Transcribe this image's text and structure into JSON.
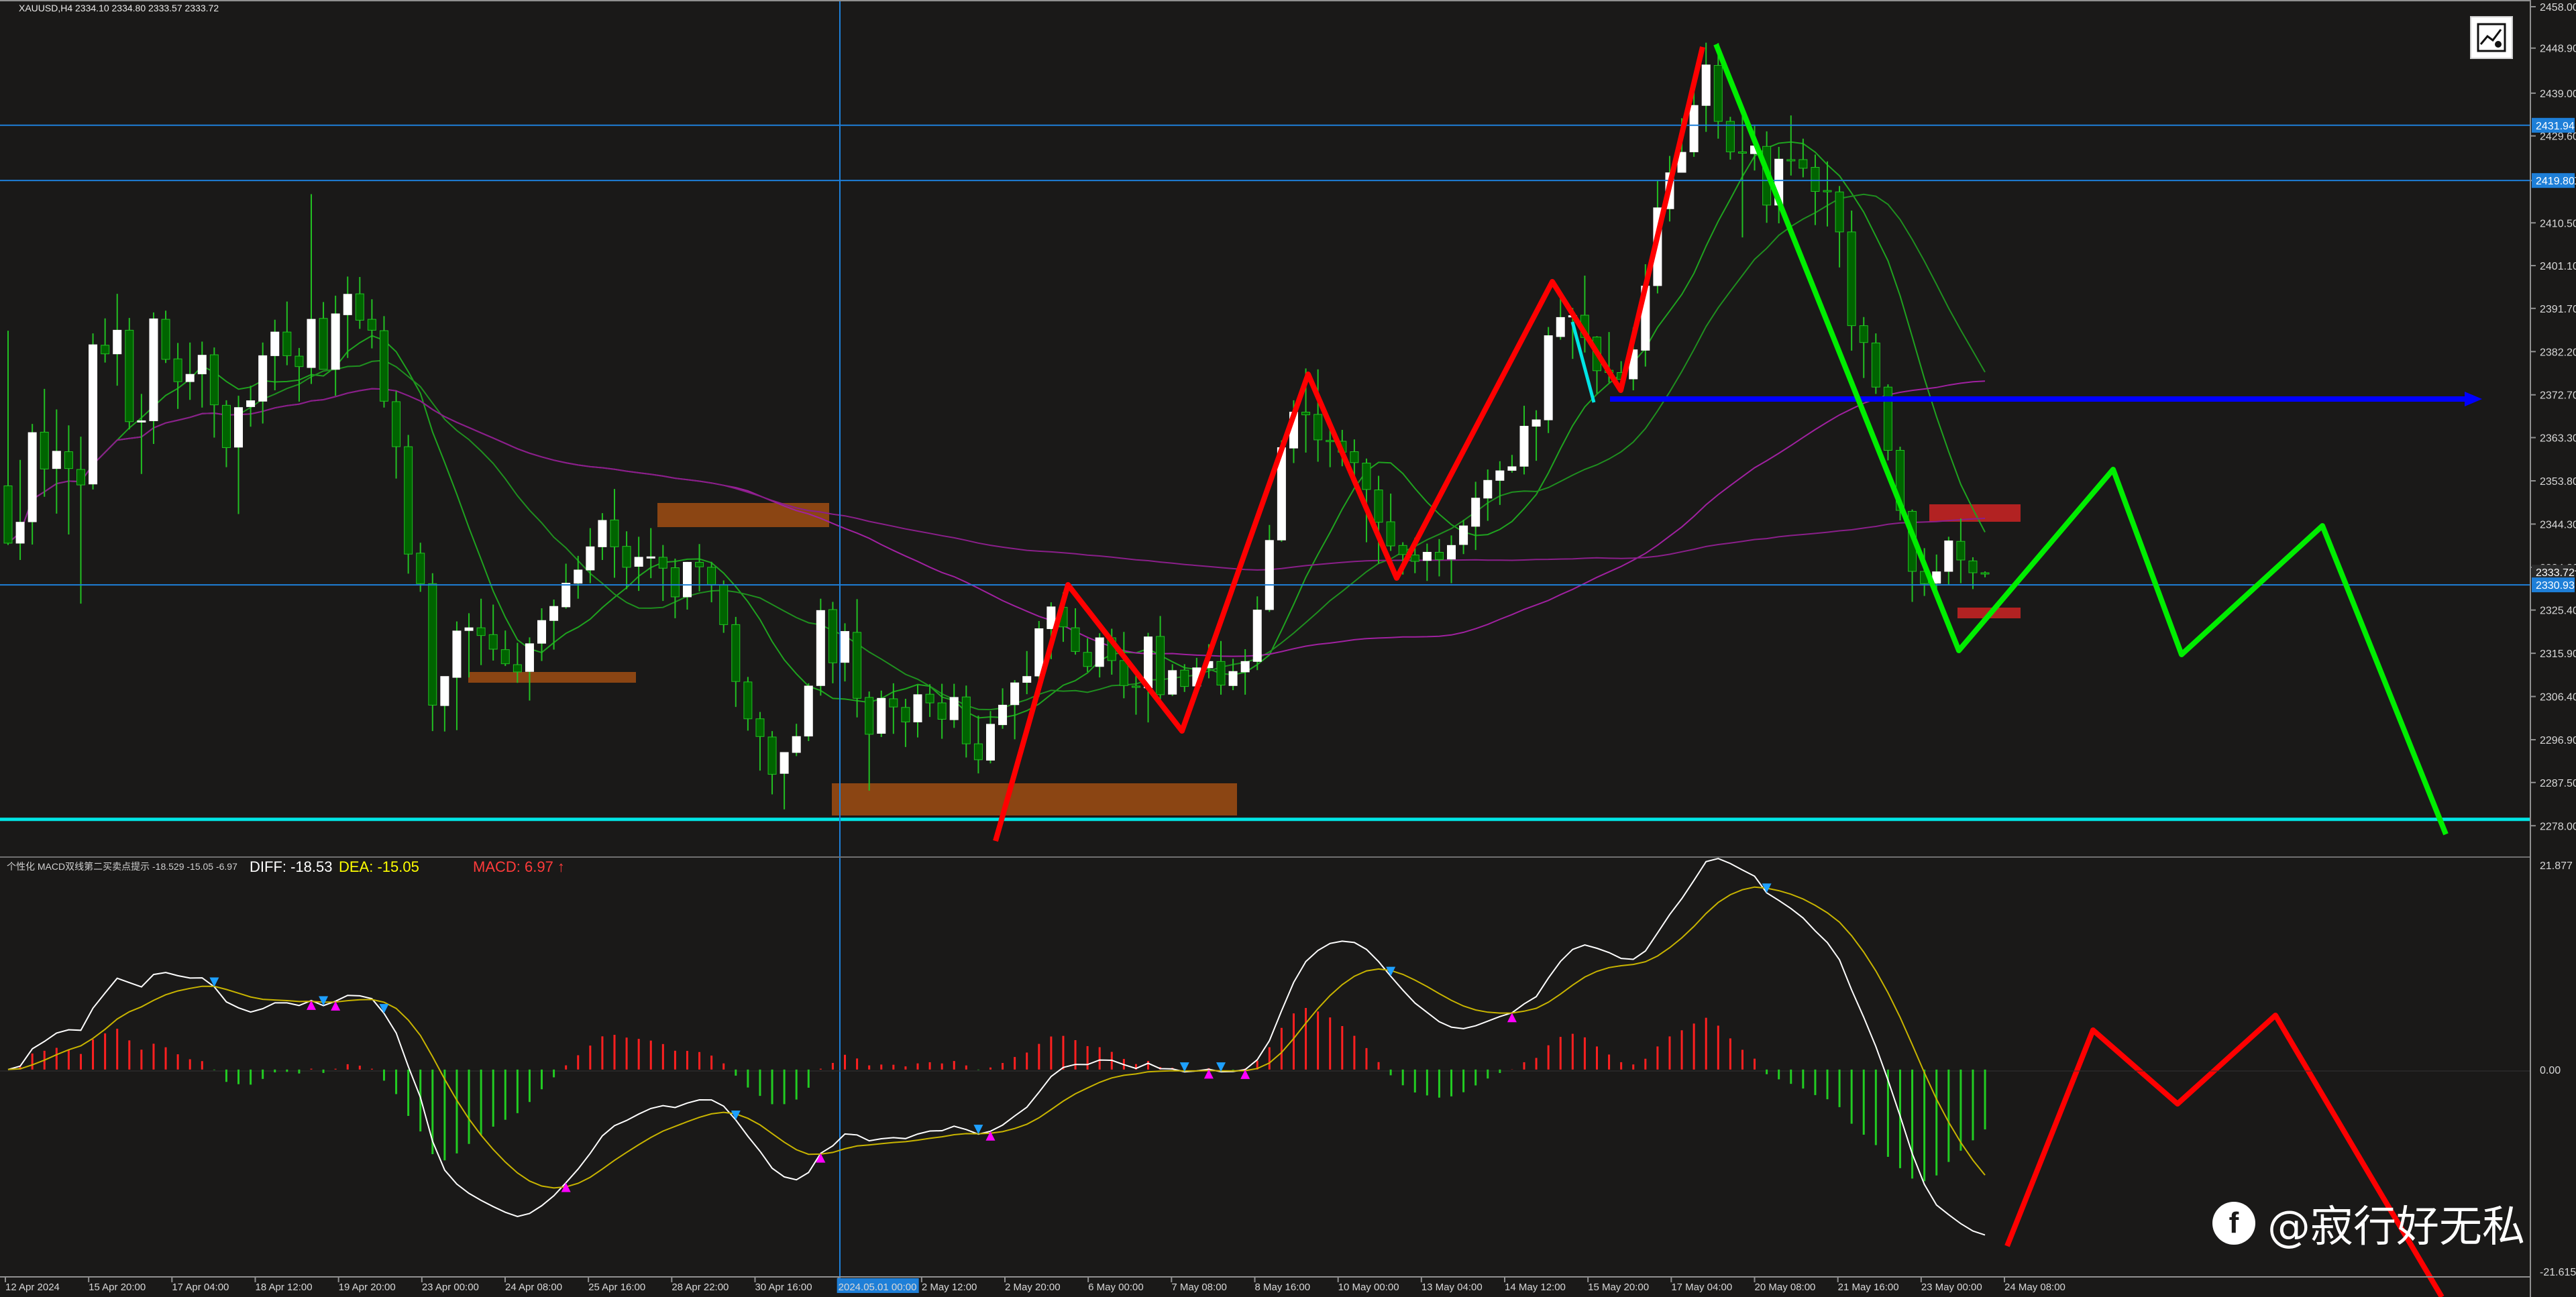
{
  "symbol_label": "XAUUSD,H4  2334.10 2334.80 2333.57 2333.72",
  "macd_indicator": {
    "label": "个性化 MACD双线第二买卖点提示 -18.529 -15.05 -6.97",
    "diff_text": "DIFF: -18.53",
    "dea_text": "DEA: -15.05",
    "macd_text": "MACD: 6.97 ↑"
  },
  "watermark": {
    "text": "@寂行好无私",
    "icon": "facebook-icon"
  },
  "logo": {
    "icon": "chart-signal-icon"
  },
  "colors": {
    "background": "#1a1918",
    "bull_candle": "#ffffff",
    "bear_candle": "#006400",
    "wick": "#22c022",
    "hline": "#1e7fd8",
    "cyan_line": "#00e5e5",
    "blue_line": "#0000ff",
    "red_arrow": "#ff0000",
    "green_arrow": "#00ee00",
    "zone_orange": "#8b4513",
    "zone_red": "#b22222",
    "diff_line": "#ffffff",
    "dea_line": "#c8b400",
    "hist_pos": "#ff2020",
    "hist_neg": "#22cc22"
  },
  "chart_data": {
    "type": "candlestick",
    "symbol": "XAUUSD",
    "timeframe": "H4",
    "ohlc_header": {
      "open": 2334.1,
      "high": 2334.8,
      "low": 2333.57,
      "close": 2333.72
    },
    "price_axis_ticks": [
      "2458.00",
      "2448.90",
      "2439.00",
      "2429.60",
      "2419.80",
      "2410.50",
      "2401.10",
      "2391.70",
      "2382.20",
      "2372.70",
      "2363.30",
      "2353.80",
      "2344.30",
      "2334.80",
      "2325.40",
      "2315.90",
      "2306.40",
      "2296.90",
      "2287.50",
      "2278.00"
    ],
    "price_range": [
      2274.5,
      2458.0
    ],
    "price_tags": [
      {
        "label": "2431.94",
        "price": 2431.94
      },
      {
        "label": "2419.80",
        "price": 2419.8
      },
      {
        "label": "2333.72",
        "price": 2333.72
      },
      {
        "label": "2330.93",
        "price": 2330.93
      }
    ],
    "time_axis_labels": [
      "12 Apr 2024",
      "15 Apr 20:00",
      "17 Apr 04:00",
      "18 Apr 12:00",
      "19 Apr 20:00",
      "23 Apr 00:00",
      "24 Apr 08:00",
      "25 Apr 16:00",
      "28 Apr 22:00",
      "30 Apr 16:00",
      "2024.05.01 00:00",
      "2 May 12:00",
      "2 May 20:00",
      "6 May 00:00",
      "7 May 08:00",
      "8 May 16:00",
      "10 May 00:00",
      "13 May 04:00",
      "14 May 12:00",
      "15 May 20:00",
      "17 May 04:00",
      "20 May 08:00",
      "21 May 16:00",
      "23 May 00:00",
      "24 May 08:00"
    ],
    "candles": [
      [
        2352.7,
        2386.8,
        2339.7,
        2340.1
      ],
      [
        2340.1,
        2358.4,
        2336.4,
        2344.7
      ],
      [
        2344.8,
        2366.3,
        2339.8,
        2364.4
      ],
      [
        2364.5,
        2374.0,
        2350.3,
        2356.4
      ],
      [
        2356.5,
        2369.5,
        2346.6,
        2360.3
      ],
      [
        2360.2,
        2366.0,
        2342.0,
        2356.5
      ],
      [
        2356.3,
        2363.5,
        2326.8,
        2352.9
      ],
      [
        2353.1,
        2386.2,
        2351.9,
        2383.7
      ],
      [
        2383.6,
        2389.5,
        2379.8,
        2381.7
      ],
      [
        2381.7,
        2394.9,
        2374.7,
        2386.9
      ],
      [
        2386.9,
        2389.6,
        2365.1,
        2366.8
      ],
      [
        2366.7,
        2372.9,
        2355.3,
        2367.0
      ],
      [
        2367.0,
        2390.8,
        2361.9,
        2389.4
      ],
      [
        2389.3,
        2391.2,
        2379.7,
        2380.5
      ],
      [
        2380.6,
        2384.1,
        2369.6,
        2375.6
      ],
      [
        2375.6,
        2384.2,
        2371.6,
        2377.2
      ],
      [
        2377.3,
        2384.4,
        2369.9,
        2381.4
      ],
      [
        2381.5,
        2383.1,
        2363.3,
        2370.5
      ],
      [
        2370.4,
        2371.5,
        2356.8,
        2361.1
      ],
      [
        2361.2,
        2372.5,
        2346.5,
        2369.9
      ],
      [
        2370.1,
        2374.7,
        2365.7,
        2371.4
      ],
      [
        2371.3,
        2384.2,
        2366.4,
        2381.3
      ],
      [
        2381.3,
        2389.2,
        2373.7,
        2386.5
      ],
      [
        2386.5,
        2393.2,
        2379.2,
        2381.3
      ],
      [
        2381.2,
        2383.0,
        2371.2,
        2378.9
      ],
      [
        2378.7,
        2416.8,
        2375.1,
        2389.3
      ],
      [
        2389.5,
        2393.1,
        2378.8,
        2378.3
      ],
      [
        2378.3,
        2394.5,
        2372.5,
        2390.5
      ],
      [
        2390.3,
        2398.7,
        2380.8,
        2394.8
      ],
      [
        2394.9,
        2398.6,
        2387.2,
        2389.1
      ],
      [
        2389.3,
        2393.7,
        2382.9,
        2386.9
      ],
      [
        2386.8,
        2390.0,
        2369.9,
        2371.3
      ],
      [
        2371.2,
        2373.5,
        2354.3,
        2361.3
      ],
      [
        2361.3,
        2363.9,
        2333.4,
        2337.7
      ],
      [
        2337.9,
        2340.2,
        2329.4,
        2331.2
      ],
      [
        2331.2,
        2333.5,
        2298.8,
        2304.5
      ],
      [
        2304.4,
        2309.6,
        2298.7,
        2310.8
      ],
      [
        2310.6,
        2322.9,
        2299.0,
        2320.8
      ],
      [
        2320.9,
        2324.7,
        2310.6,
        2321.5
      ],
      [
        2321.5,
        2327.9,
        2313.3,
        2319.8
      ],
      [
        2320.0,
        2326.6,
        2314.3,
        2316.8
      ],
      [
        2316.7,
        2320.9,
        2313.1,
        2313.6
      ],
      [
        2313.4,
        2318.2,
        2309.4,
        2311.8
      ],
      [
        2311.9,
        2319.4,
        2305.5,
        2318.0
      ],
      [
        2318.1,
        2325.8,
        2314.2,
        2323.1
      ],
      [
        2323.1,
        2327.7,
        2316.7,
        2326.2
      ],
      [
        2326.1,
        2335.6,
        2325.7,
        2331.3
      ],
      [
        2331.3,
        2337.3,
        2327.9,
        2334.2
      ],
      [
        2334.2,
        2343.4,
        2331.3,
        2339.3
      ],
      [
        2339.3,
        2346.7,
        2336.4,
        2345.1
      ],
      [
        2345.2,
        2352.0,
        2332.5,
        2339.3
      ],
      [
        2339.4,
        2342.7,
        2330.0,
        2334.8
      ],
      [
        2335.0,
        2341.5,
        2329.6,
        2337.0
      ],
      [
        2337.0,
        2343.4,
        2332.4,
        2337.1
      ],
      [
        2337.0,
        2339.7,
        2327.4,
        2334.6
      ],
      [
        2334.7,
        2336.7,
        2323.6,
        2328.3
      ],
      [
        2328.3,
        2336.0,
        2325.5,
        2335.9
      ],
      [
        2335.9,
        2339.9,
        2329.5,
        2334.9
      ],
      [
        2334.8,
        2336.0,
        2327.1,
        2331.0
      ],
      [
        2330.9,
        2331.9,
        2320.4,
        2322.2
      ],
      [
        2322.2,
        2323.9,
        2304.1,
        2309.7
      ],
      [
        2309.6,
        2310.7,
        2298.9,
        2301.5
      ],
      [
        2301.5,
        2303.0,
        2290.1,
        2297.6
      ],
      [
        2297.5,
        2298.8,
        2284.9,
        2289.3
      ],
      [
        2289.5,
        2294.1,
        2281.6,
        2294.1
      ],
      [
        2294.1,
        2300.4,
        2293.3,
        2297.6
      ],
      [
        2297.7,
        2309.3,
        2296.6,
        2308.7
      ],
      [
        2308.8,
        2327.9,
        2306.6,
        2325.3
      ],
      [
        2325.5,
        2327.2,
        2309.3,
        2313.8
      ],
      [
        2313.9,
        2322.5,
        2309.7,
        2320.7
      ],
      [
        2320.5,
        2327.8,
        2301.8,
        2306.0
      ],
      [
        2306.2,
        2307.5,
        2285.7,
        2298.1
      ],
      [
        2298.3,
        2307.7,
        2297.5,
        2306.0
      ],
      [
        2305.9,
        2309.3,
        2298.2,
        2304.1
      ],
      [
        2304.0,
        2305.9,
        2295.3,
        2300.8
      ],
      [
        2300.8,
        2308.9,
        2297.4,
        2306.8
      ],
      [
        2306.9,
        2309.1,
        2301.9,
        2305.0
      ],
      [
        2305.0,
        2309.2,
        2297.1,
        2301.4
      ],
      [
        2301.3,
        2309.2,
        2299.5,
        2306.2
      ],
      [
        2306.3,
        2308.8,
        2293.0,
        2296.0
      ],
      [
        2296.0,
        2302.2,
        2289.5,
        2292.5
      ],
      [
        2292.4,
        2303.2,
        2291.7,
        2300.3
      ],
      [
        2300.2,
        2308.2,
        2299.3,
        2304.5
      ],
      [
        2304.6,
        2310.0,
        2297.0,
        2309.4
      ],
      [
        2309.5,
        2316.4,
        2306.9,
        2310.8
      ],
      [
        2310.9,
        2323.0,
        2306.4,
        2321.3
      ],
      [
        2321.3,
        2327.1,
        2314.6,
        2326.1
      ],
      [
        2326.0,
        2329.3,
        2318.4,
        2321.7
      ],
      [
        2321.5,
        2325.8,
        2315.6,
        2316.3
      ],
      [
        2316.1,
        2319.2,
        2311.8,
        2313.0
      ],
      [
        2313.0,
        2320.3,
        2310.6,
        2319.3
      ],
      [
        2319.3,
        2321.3,
        2311.2,
        2314.3
      ],
      [
        2314.3,
        2320.6,
        2306.0,
        2308.8
      ],
      [
        2308.7,
        2311.4,
        2302.4,
        2308.5
      ],
      [
        2308.3,
        2320.4,
        2300.7,
        2319.5
      ],
      [
        2319.6,
        2324.1,
        2305.4,
        2306.8
      ],
      [
        2306.9,
        2313.5,
        2306.5,
        2312.1
      ],
      [
        2312.2,
        2313.5,
        2307.4,
        2308.6
      ],
      [
        2308.7,
        2314.9,
        2307.0,
        2312.7
      ],
      [
        2312.7,
        2317.9,
        2310.4,
        2314.1
      ],
      [
        2314.1,
        2318.6,
        2306.8,
        2308.9
      ],
      [
        2308.8,
        2314.7,
        2307.8,
        2311.9
      ],
      [
        2311.8,
        2316.8,
        2306.8,
        2314.1
      ],
      [
        2314.1,
        2328.4,
        2312.2,
        2325.4
      ],
      [
        2325.5,
        2344.1,
        2325.0,
        2340.7
      ],
      [
        2340.8,
        2362.7,
        2340.4,
        2361.1
      ],
      [
        2361.0,
        2371.5,
        2357.7,
        2368.9
      ],
      [
        2368.9,
        2378.5,
        2360.0,
        2368.3
      ],
      [
        2368.4,
        2378.3,
        2358.0,
        2362.8
      ],
      [
        2362.7,
        2367.4,
        2356.8,
        2362.4
      ],
      [
        2362.5,
        2365.0,
        2357.0,
        2360.1
      ],
      [
        2360.2,
        2362.9,
        2353.7,
        2357.8
      ],
      [
        2357.7,
        2358.7,
        2340.3,
        2351.9
      ],
      [
        2351.8,
        2354.9,
        2335.6,
        2344.7
      ],
      [
        2344.8,
        2351.0,
        2338.4,
        2339.5
      ],
      [
        2339.6,
        2340.3,
        2333.2,
        2337.6
      ],
      [
        2337.5,
        2341.3,
        2333.5,
        2336.1
      ],
      [
        2336.3,
        2340.0,
        2331.8,
        2338.1
      ],
      [
        2338.1,
        2341.0,
        2332.8,
        2336.5
      ],
      [
        2336.6,
        2341.8,
        2331.3,
        2339.6
      ],
      [
        2339.8,
        2345.2,
        2337.7,
        2343.9
      ],
      [
        2343.8,
        2353.6,
        2338.6,
        2350.0
      ],
      [
        2350.0,
        2356.3,
        2345.0,
        2353.9
      ],
      [
        2353.9,
        2358.1,
        2348.5,
        2356.0
      ],
      [
        2356.1,
        2359.5,
        2355.6,
        2356.9
      ],
      [
        2357.0,
        2370.3,
        2355.2,
        2365.8
      ],
      [
        2365.8,
        2369.3,
        2358.2,
        2367.2
      ],
      [
        2367.2,
        2387.6,
        2364.3,
        2385.7
      ],
      [
        2385.5,
        2394.5,
        2384.8,
        2389.7
      ],
      [
        2389.8,
        2391.8,
        2380.6,
        2390.1
      ],
      [
        2390.2,
        2398.9,
        2382.0,
        2385.3
      ],
      [
        2385.4,
        2385.6,
        2373.0,
        2378.0
      ],
      [
        2378.1,
        2386.5,
        2375.4,
        2377.6
      ],
      [
        2377.6,
        2380.1,
        2373.3,
        2376.1
      ],
      [
        2376.2,
        2387.5,
        2373.7,
        2382.6
      ],
      [
        2382.5,
        2401.4,
        2378.9,
        2396.6
      ],
      [
        2396.7,
        2419.7,
        2395.0,
        2413.8
      ],
      [
        2413.6,
        2425.2,
        2410.8,
        2421.5
      ],
      [
        2421.6,
        2433.5,
        2421.6,
        2426.0
      ],
      [
        2426.1,
        2439.2,
        2425.0,
        2436.3
      ],
      [
        2436.3,
        2450.1,
        2430.5,
        2445.2
      ],
      [
        2445.1,
        2450.0,
        2429.0,
        2432.8
      ],
      [
        2432.8,
        2433.8,
        2424.4,
        2426.1
      ],
      [
        2426.1,
        2434.0,
        2407.3,
        2425.8
      ],
      [
        2425.7,
        2431.8,
        2422.0,
        2427.4
      ],
      [
        2427.3,
        2430.6,
        2410.5,
        2414.4
      ],
      [
        2414.4,
        2427.2,
        2410.4,
        2424.5
      ],
      [
        2424.4,
        2434.1,
        2420.9,
        2424.2
      ],
      [
        2424.4,
        2429.0,
        2420.5,
        2422.5
      ],
      [
        2422.7,
        2425.5,
        2410.0,
        2417.4
      ],
      [
        2417.6,
        2424.0,
        2409.7,
        2417.5
      ],
      [
        2417.3,
        2418.6,
        2400.7,
        2408.5
      ],
      [
        2408.5,
        2413.2,
        2382.4,
        2387.9
      ],
      [
        2387.9,
        2389.8,
        2376.4,
        2384.2
      ],
      [
        2384.1,
        2386.2,
        2372.9,
        2374.4
      ],
      [
        2374.4,
        2375.0,
        2358.3,
        2360.5
      ],
      [
        2360.5,
        2361.3,
        2345.1,
        2347.3
      ],
      [
        2347.1,
        2347.5,
        2327.2,
        2333.9
      ],
      [
        2333.9,
        2339.0,
        2328.5,
        2331.2
      ],
      [
        2331.3,
        2337.6,
        2329.7,
        2333.8
      ],
      [
        2333.9,
        2341.5,
        2331.0,
        2340.6
      ],
      [
        2340.5,
        2345.5,
        2331.3,
        2336.4
      ],
      [
        2336.2,
        2337.0,
        2330.0,
        2333.6
      ],
      [
        2333.6,
        2333.9,
        2332.6,
        2333.5
      ]
    ],
    "horizontal_lines": [
      {
        "price": 2431.94,
        "color": "#1e7fd8",
        "style": "thin"
      },
      {
        "price": 2419.8,
        "color": "#1e7fd8",
        "style": "thin"
      },
      {
        "price": 2330.93,
        "color": "#1e7fd8",
        "style": "thin"
      },
      {
        "price": 2279.4,
        "color": "#00e5e5",
        "style": "thick"
      }
    ],
    "vertical_line_time": "2024.05.01 00:00",
    "indicator": {
      "name": "个性化 MACD双线第二买卖点提示",
      "params": [
        -18.529,
        -15.05,
        -6.97
      ],
      "diff": -18.53,
      "dea": -15.05,
      "macd": 6.97,
      "y_axis_ticks": [
        "21.877",
        "0.00",
        "-21.615"
      ],
      "y_range": [
        -21.615,
        21.877
      ]
    }
  }
}
